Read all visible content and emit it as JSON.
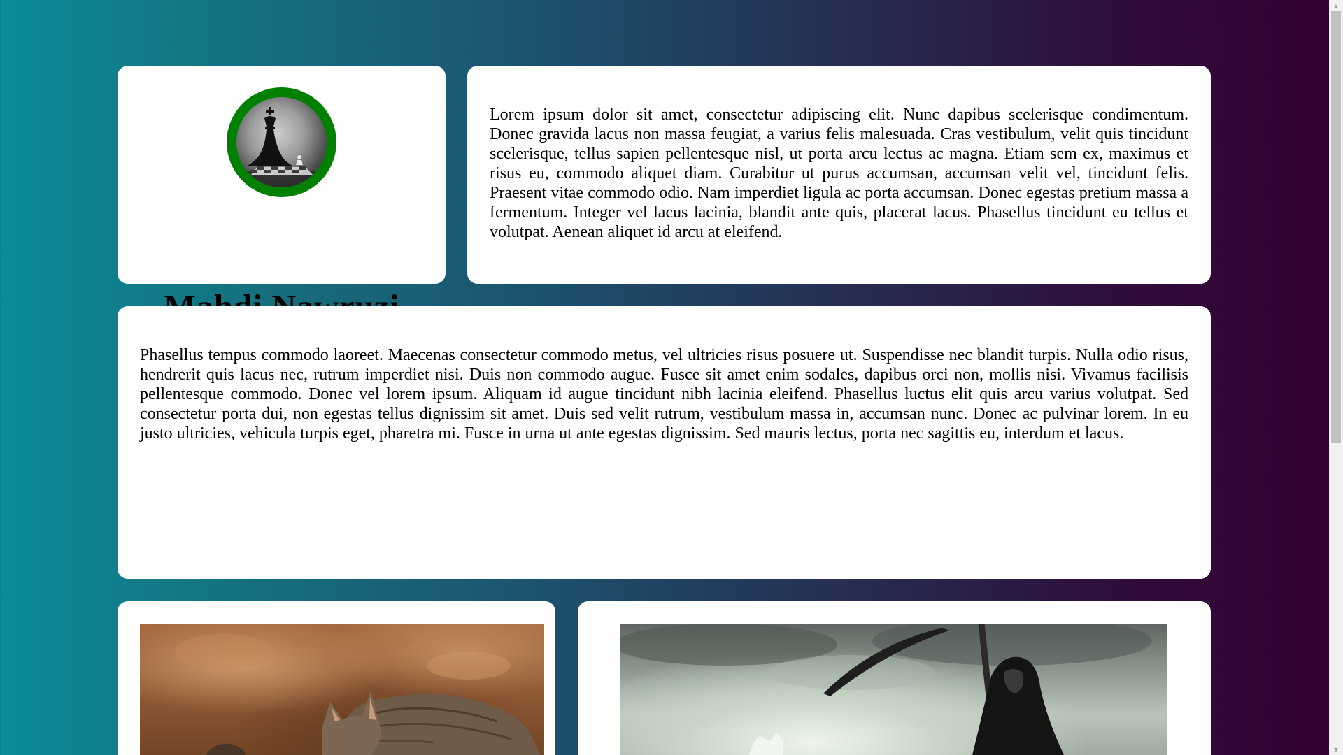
{
  "profile": {
    "name": "Mahdi Nawruzi",
    "avatar_icon": "chess-king-shadow-icon",
    "avatar_ring_color": "#008000"
  },
  "intro": {
    "text": "Lorem ipsum dolor sit amet, consectetur adipiscing elit. Nunc dapibus scelerisque condimentum. Donec gravida lacus non massa feugiat, a varius felis malesuada. Cras vestibulum, velit quis tincidunt scelerisque, tellus sapien pellentesque nisl, ut porta arcu lectus ac magna. Etiam sem ex, maximus et risus eu, commodo aliquet diam. Curabitur ut purus accumsan, accumsan velit vel, tincidunt felis. Praesent vitae commodo odio. Nam imperdiet ligula ac porta accumsan. Donec egestas pretium massa a fermentum. Integer vel lacus lacinia, blandit ante quis, placerat lacus. Phasellus tincidunt eu tellus et volutpat. Aenean aliquet id arcu at eleifend."
  },
  "bio": {
    "text": "Phasellus tempus commodo laoreet. Maecenas consectetur commodo metus, vel ultricies risus posuere ut. Suspendisse nec blandit turpis. Nulla odio risus, hendrerit quis lacus nec, rutrum imperdiet nisi. Duis non commodo augue. Fusce sit amet enim sodales, dapibus orci non, mollis nisi. Vivamus facilisis pellentesque commodo. Donec vel lorem ipsum. Aliquam id augue tincidunt nibh lacinia eleifend. Phasellus luctus elit quis arcu varius volutpat. Sed consectetur porta dui, non egestas tellus dignissim sit amet. Duis sed velit rutrum, vestibulum massa in, accumsan nunc. Donec ac pulvinar lorem. In eu justo ultricies, vehicula turpis eget, pharetra mi. Fusce in urna ut ante egestas dignissim. Sed mauris lectus, porta nec sagittis eu, interdum et lacus."
  },
  "gallery": {
    "left_image_icon": "cat-painting-image",
    "right_image_icon": "grim-reaper-image"
  },
  "colors": {
    "gradient_start": "#0b8b98",
    "gradient_end": "#34002f",
    "card_background": "#ffffff"
  }
}
